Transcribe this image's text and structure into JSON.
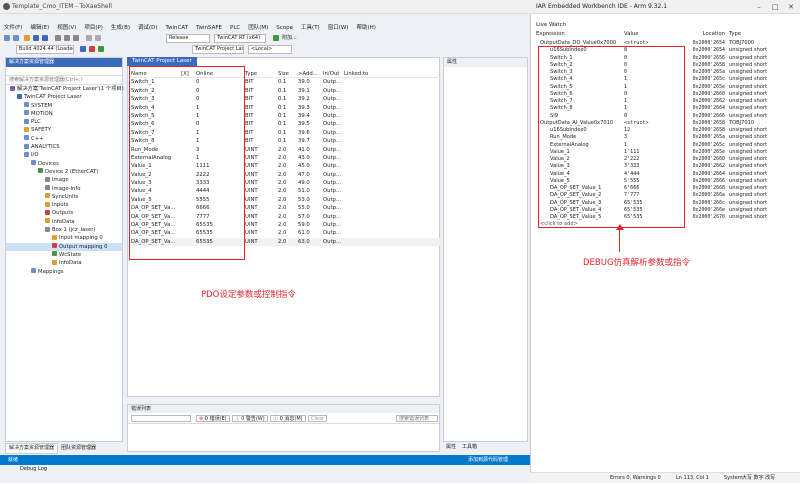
{
  "window": {
    "title": "Template_Cmo_ITEM - ToXaeShell",
    "right_title": "IAR Embedded Workbench IDE - Arm 9.32.1"
  },
  "menu": [
    "文件(F)",
    "编辑(E)",
    "视图(V)",
    "项目(P)",
    "生成(B)",
    "调试(D)",
    "TwinCAT",
    "TwinSAFE",
    "PLC",
    "团队(M)",
    "Scope",
    "工具(T)",
    "窗口(W)",
    "帮助(H)"
  ],
  "toolbar": {
    "config": "Release",
    "platform": "TwinCAT RT (x64)",
    "attach": "附加...",
    "build": "Build 4024.44 (Loaded",
    "project": "TwinCAT Project Laser",
    "target": "<Local>"
  },
  "solution": {
    "header": "解决方案资源管理器",
    "search_placeholder": "搜索解决方案资源管理器(Ctrl+;)",
    "tree": [
      {
        "label": "解决方案'TwinCAT Project Laser'(1 个项目)",
        "indent": 0,
        "color": "#7b61a6"
      },
      {
        "label": "TwinCAT Project Laser",
        "indent": 1,
        "color": "#3c6bbd"
      },
      {
        "label": "SYSTEM",
        "indent": 2,
        "color": "#6b8fc9"
      },
      {
        "label": "MOTION",
        "indent": 2,
        "color": "#6b8fc9"
      },
      {
        "label": "PLC",
        "indent": 2,
        "color": "#6b8fc9"
      },
      {
        "label": "SAFETY",
        "indent": 2,
        "color": "#e0a030"
      },
      {
        "label": "C++",
        "indent": 2,
        "color": "#6b8fc9"
      },
      {
        "label": "ANALYTICS",
        "indent": 2,
        "color": "#6b8fc9"
      },
      {
        "label": "I/O",
        "indent": 2,
        "color": "#6b8fc9"
      },
      {
        "label": "Devices",
        "indent": 3,
        "color": "#6b8fc9"
      },
      {
        "label": "Device 2 (EtherCAT)",
        "indent": 4,
        "color": "#4a8f4a"
      },
      {
        "label": "Image",
        "indent": 5,
        "color": "#888888"
      },
      {
        "label": "Image-Info",
        "indent": 5,
        "color": "#888888"
      },
      {
        "label": "SyncUnits",
        "indent": 5,
        "color": "#e0a030"
      },
      {
        "label": "Inputs",
        "indent": 5,
        "color": "#e0a030"
      },
      {
        "label": "Outputs",
        "indent": 5,
        "color": "#d04040"
      },
      {
        "label": "InfoData",
        "indent": 5,
        "color": "#e0a030"
      },
      {
        "label": "Box 1 (jcz_laser)",
        "indent": 5,
        "color": "#888888"
      },
      {
        "label": "Input mapping 0",
        "indent": 6,
        "color": "#e0a030"
      },
      {
        "label": "Output mapping 0",
        "indent": 6,
        "color": "#d04040",
        "selected": true
      },
      {
        "label": "WcState",
        "indent": 6,
        "color": "#4a8f4a"
      },
      {
        "label": "InfoData",
        "indent": 6,
        "color": "#e0a030"
      },
      {
        "label": "Mappings",
        "indent": 3,
        "color": "#6b8fc9"
      }
    ],
    "tabs": [
      "解决方案资源管理器",
      "团队资源管理器"
    ]
  },
  "doc_tab": "TwinCAT Project Laser",
  "pdo_table": {
    "columns": [
      "Name",
      "[X]",
      "Online",
      "Type",
      "Size",
      ">Add...",
      "In/Out",
      "Linked to"
    ],
    "rows": [
      [
        "Switch_1",
        "",
        "0",
        "BIT",
        "0.1",
        "39.0",
        "Outp..."
      ],
      [
        "Switch_2",
        "",
        "0",
        "BIT",
        "0.1",
        "39.1",
        "Outp..."
      ],
      [
        "Switch_3",
        "",
        "0",
        "BIT",
        "0.1",
        "39.2",
        "Outp..."
      ],
      [
        "Switch_4",
        "",
        "1",
        "BIT",
        "0.1",
        "39.3",
        "Outp..."
      ],
      [
        "Switch_5",
        "",
        "1",
        "BIT",
        "0.1",
        "39.4",
        "Outp..."
      ],
      [
        "Switch_6",
        "",
        "0",
        "BIT",
        "0.1",
        "39.5",
        "Outp..."
      ],
      [
        "Switch_7",
        "",
        "1",
        "BIT",
        "0.1",
        "39.6",
        "Outp..."
      ],
      [
        "Switch_8",
        "",
        "1",
        "BIT",
        "0.1",
        "39.7",
        "Outp..."
      ],
      [
        "Run_Mode",
        "",
        "3",
        "UINT",
        "2.0",
        "41.0",
        "Outp..."
      ],
      [
        "ExternalAnalog",
        "",
        "1",
        "UINT",
        "2.0",
        "43.0",
        "Outp..."
      ],
      [
        "Value_1",
        "",
        "1111",
        "UINT",
        "2.0",
        "45.0",
        "Outp..."
      ],
      [
        "Value_2",
        "",
        "2222",
        "UINT",
        "2.0",
        "47.0",
        "Outp..."
      ],
      [
        "Value_3",
        "",
        "3333",
        "UINT",
        "2.0",
        "49.0",
        "Outp..."
      ],
      [
        "Value_4",
        "",
        "4444",
        "UINT",
        "2.0",
        "51.0",
        "Outp..."
      ],
      [
        "Value_5",
        "",
        "5555",
        "UINT",
        "2.0",
        "53.0",
        "Outp..."
      ],
      [
        "DA_OP_SET_Va...",
        "",
        "6666",
        "UINT",
        "2.0",
        "55.0",
        "Outp..."
      ],
      [
        "DA_OP_SET_Va...",
        "",
        "7777",
        "UINT",
        "2.0",
        "57.0",
        "Outp..."
      ],
      [
        "DA_OP_SET_Va...",
        "",
        "65535",
        "UINT",
        "2.0",
        "59.0",
        "Outp..."
      ],
      [
        "DA_OP_SET_Va...",
        "",
        "65535",
        "UINT",
        "2.0",
        "61.0",
        "Outp..."
      ],
      [
        "DA_OP_SET_Va...",
        "",
        "65535",
        "UINT",
        "2.0",
        "63.0",
        "Outp..."
      ]
    ]
  },
  "pdo_caption": "PDO设定参数或控制指令",
  "properties": {
    "header": "属性",
    "tabs": [
      "属性",
      "工具箱"
    ]
  },
  "error_list": {
    "header": "错误列表",
    "errors": "0 错误(E)",
    "warnings": "0 警告(W)",
    "messages": "0 消息(M)",
    "clear": "Clear",
    "search": "搜索错误列表"
  },
  "status": {
    "left": "就绪",
    "right": "添加到源代码管理"
  },
  "live_watch": {
    "title": "Live Watch",
    "columns": [
      "Expression",
      "Value",
      "Location",
      "Type"
    ],
    "rows": [
      [
        "OutputData_DO_Value0x7000",
        "<struct>",
        "0x2000'2654",
        "TOBJ7000"
      ],
      [
        "u16SubIndex0",
        "8",
        "0x2000'2654",
        "unsigned short"
      ],
      [
        "Switch_1",
        "0",
        "0x2000'2656",
        "unsigned short"
      ],
      [
        "Switch_2",
        "0",
        "0x2000'2658",
        "unsigned short"
      ],
      [
        "Switch_3",
        "0",
        "0x2000'265a",
        "unsigned short"
      ],
      [
        "Switch_4",
        "1",
        "0x2000'265c",
        "unsigned short"
      ],
      [
        "Switch_5",
        "1",
        "0x2000'265e",
        "unsigned short"
      ],
      [
        "Switch_6",
        "0",
        "0x2000'2660",
        "unsigned short"
      ],
      [
        "Switch_7",
        "1",
        "0x2000'2662",
        "unsigned short"
      ],
      [
        "Switch_8",
        "1",
        "0x2000'2664",
        "unsigned short"
      ],
      [
        "SI9",
        "0",
        "0x2000'2666",
        "unsigned short"
      ],
      [
        "OutputData_AI_Value0x7010",
        "<struct>",
        "0x2000'2658",
        "TOBJ7010"
      ],
      [
        "u16SubIndex0",
        "12",
        "0x2000'2658",
        "unsigned short"
      ],
      [
        "Run_Mode",
        "3",
        "0x2000'265a",
        "unsigned short"
      ],
      [
        "ExternalAnalog",
        "1",
        "0x2000'265c",
        "unsigned short"
      ],
      [
        "Value_1",
        "1'111",
        "0x2000'265e",
        "unsigned short"
      ],
      [
        "Value_2",
        "2'222",
        "0x2000'2660",
        "unsigned short"
      ],
      [
        "Value_3",
        "3'333",
        "0x2000'2662",
        "unsigned short"
      ],
      [
        "Value_4",
        "4'444",
        "0x2000'2664",
        "unsigned short"
      ],
      [
        "Value_5",
        "5'555",
        "0x2000'2666",
        "unsigned short"
      ],
      [
        "DA_OP_SET_Value_1",
        "6'666",
        "0x2000'2668",
        "unsigned short"
      ],
      [
        "DA_OP_SET_Value_2",
        "7'777",
        "0x2000'266a",
        "unsigned short"
      ],
      [
        "DA_OP_SET_Value_3",
        "65'535",
        "0x2000'266c",
        "unsigned short"
      ],
      [
        "DA_OP_SET_Value_4",
        "65'535",
        "0x2000'266e",
        "unsigned short"
      ],
      [
        "DA_OP_SET_Value_5",
        "65'535",
        "0x2000'2670",
        "unsigned short"
      ],
      [
        "<click to add>",
        "",
        "",
        ""
      ]
    ]
  },
  "debug_caption": "DEBUG仿真解析参数或指令",
  "right_status": {
    "errors": "Errors 0, Warnings 0",
    "pos": "Ln 113, Col 1",
    "sys": "System",
    "ime": "大写 数字 改写"
  },
  "debug_log": "Debug Log",
  "colors": {
    "accent": "#3c6bbd",
    "annotation": "#e3242b",
    "status": "#007acc"
  }
}
